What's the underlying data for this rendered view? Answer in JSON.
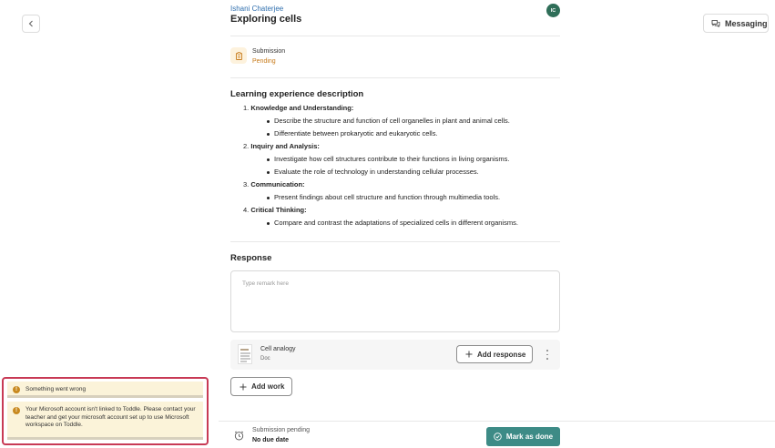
{
  "header": {
    "student_name": "Ishani Chaterjee",
    "task_title": "Exploring cells",
    "avatar_initials": "IC"
  },
  "top_actions": {
    "messaging_label": "Messaging"
  },
  "submission": {
    "label": "Submission",
    "status": "Pending"
  },
  "description": {
    "title": "Learning experience description",
    "objectives": [
      {
        "number": "1.",
        "heading": "Knowledge and Understanding:",
        "items": [
          "Describe the structure and function of cell organelles in plant and animal cells.",
          "Differentiate between prokaryotic and eukaryotic cells."
        ]
      },
      {
        "number": "2.",
        "heading": "Inquiry and Analysis:",
        "items": [
          "Investigate how cell structures contribute to their functions in living organisms.",
          "Evaluate the role of technology in understanding cellular processes."
        ]
      },
      {
        "number": "3.",
        "heading": "Communication:",
        "items": [
          "Present findings about cell structure and function through multimedia tools."
        ]
      },
      {
        "number": "4.",
        "heading": "Critical Thinking:",
        "items": [
          "Compare and contrast the adaptations of specialized cells in different organisms."
        ]
      }
    ]
  },
  "response": {
    "title": "Response",
    "remark_placeholder": "Type remark here",
    "attachment": {
      "name": "Cell analogy",
      "type": "Doc",
      "add_response_label": "Add response"
    },
    "add_work_label": "Add work"
  },
  "footer": {
    "status": "Submission pending",
    "due": "No due date",
    "mark_done_label": "Mark as done"
  },
  "toasts": [
    {
      "message": "Something went wrong",
      "progress": 1.0
    },
    {
      "message": "Your Microsoft account isn't linked to Toddle. Please contact your teacher and get your microsoft account set up to use Microsoft workspace on Toddle.",
      "progress": 1.0
    }
  ],
  "colors": {
    "accent_teal": "#3d8b86",
    "pending_orange": "#c77a1a",
    "link_blue": "#2f6fae",
    "avatar_green": "#2f6e58",
    "toast_bg": "#fbf3d9",
    "alert_border": "#c83a55"
  },
  "icons": {
    "back": "chevron-left-icon",
    "messaging": "chat-bubbles-icon",
    "submission": "clipboard-icon",
    "add": "plus-icon",
    "more": "kebab-menu-icon",
    "pending": "clock-icon",
    "done": "check-circle-icon",
    "warning": "warning-icon"
  }
}
